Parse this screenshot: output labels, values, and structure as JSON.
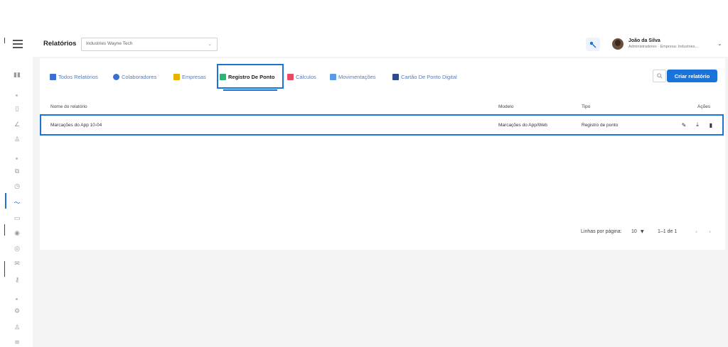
{
  "header": {
    "title": "Relatórios",
    "company_select": {
      "value": "Industries Wayne Tech"
    },
    "user": {
      "name": "João da Silva",
      "role": "Administradores · Empresa: Industries..."
    }
  },
  "tabs": [
    {
      "label": "Todos Relatórios",
      "icon": "list-icon",
      "color": "#3b6fd0"
    },
    {
      "label": "Colaboradores",
      "icon": "people-icon",
      "color": "#3b6fd0"
    },
    {
      "label": "Empresas",
      "icon": "building-icon",
      "color": "#e8b100"
    },
    {
      "label": "Registro De Ponto",
      "icon": "clock-calendar-icon",
      "color": "#2bb673",
      "active": true
    },
    {
      "label": "Cálculos",
      "icon": "calculator-icon",
      "color": "#e84a5f"
    },
    {
      "label": "Movimentações",
      "icon": "movement-icon",
      "color": "#5a9be8"
    },
    {
      "label": "Cartão De Ponto Digital",
      "icon": "card-edit-icon",
      "color": "#2c4a8c"
    }
  ],
  "toolbar": {
    "create_label": "Criar relatório"
  },
  "table": {
    "columns": [
      "Nome do relatório",
      "Modelo",
      "Tipo",
      "Ações"
    ],
    "rows": [
      {
        "name": "Marcações do App 10-04",
        "model": "Marcações do App/Web",
        "type": "Registro de ponto"
      }
    ]
  },
  "pagination": {
    "rows_per_page_label": "Linhas por página:",
    "rows_per_page": "10",
    "range": "1–1 de 1"
  },
  "colors": {
    "accent": "#1a73d9",
    "background": "#f4f4f4"
  }
}
